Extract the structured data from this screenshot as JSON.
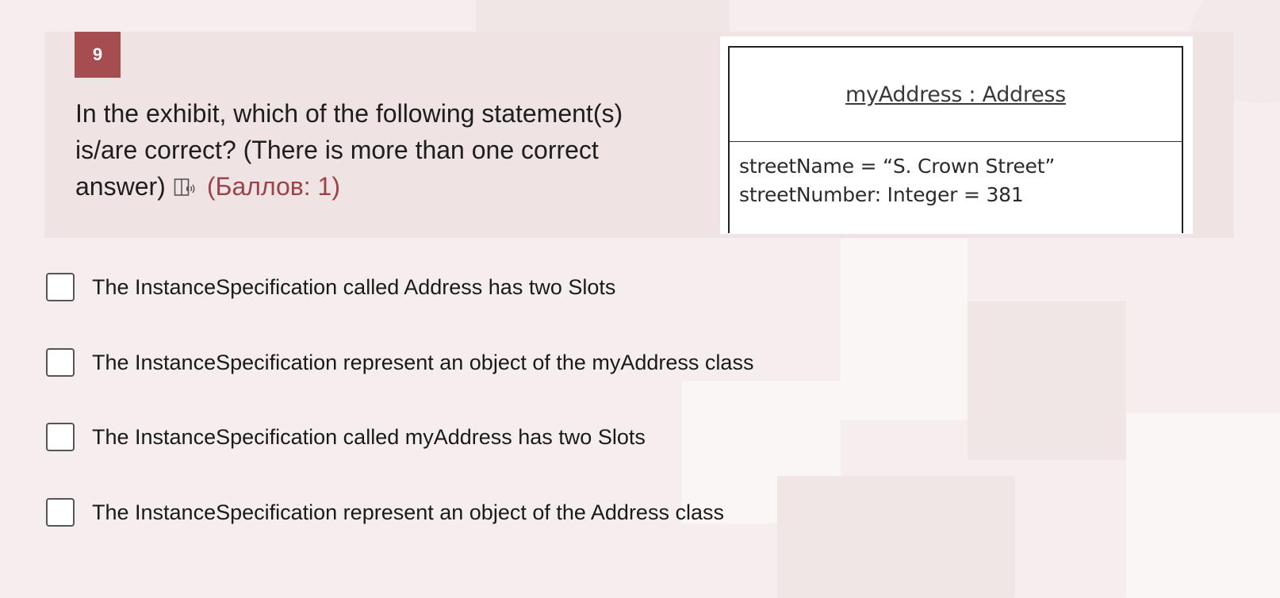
{
  "question": {
    "number": "9",
    "text": "In the exhibit, which of the following statement(s) is/are correct? (There is more than one correct answer)",
    "points": "(Баллов: 1)",
    "audio_icon": "read-aloud-icon"
  },
  "exhibit": {
    "object_title": "myAddress : Address",
    "slots": [
      "streetName = “S. Crown Street”",
      "streetNumber: Integer = 381"
    ]
  },
  "options": [
    {
      "label": "The InstanceSpecification called Address has two Slots",
      "checked": false
    },
    {
      "label": "The InstanceSpecification represent an object of the myAddress class",
      "checked": false
    },
    {
      "label": "The InstanceSpecification called myAddress has two Slots",
      "checked": false
    },
    {
      "label": "The InstanceSpecification represent an object of the Address class",
      "checked": false
    }
  ],
  "colors": {
    "accent": "#a64d52",
    "points": "#9a4449",
    "panel": "#efe3e3",
    "background": "#f6eeee"
  }
}
